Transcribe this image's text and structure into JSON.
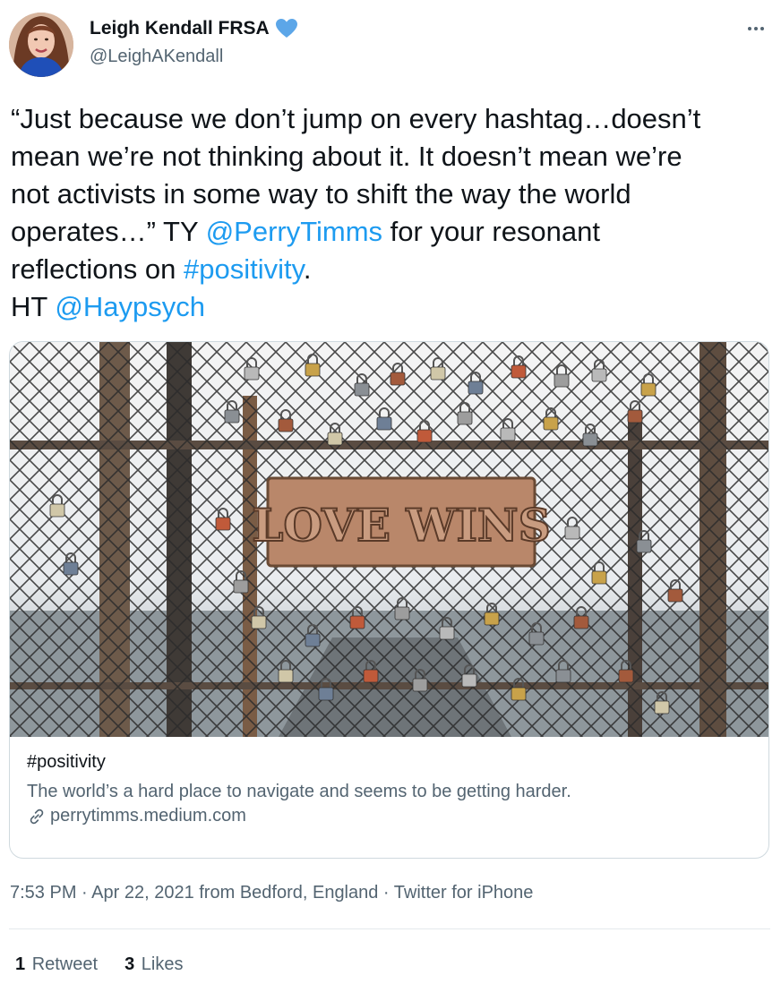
{
  "author": {
    "display_name": "Leigh Kendall FRSA",
    "handle": "@LeighAKendall",
    "verified_icon": "verified-heart-icon",
    "verified_color": "#5ca6e8"
  },
  "tweet": {
    "lines": [
      [
        {
          "t": "“Just because we don’t jump on every hashtag…doesn’t",
          "k": "text"
        }
      ],
      [
        {
          "t": "mean we’re not thinking about it. It doesn’t mean we’re",
          "k": "text"
        }
      ],
      [
        {
          "t": "not activists in some way to shift the way the world",
          "k": "text"
        }
      ],
      [
        {
          "t": "operates…” TY ",
          "k": "text"
        },
        {
          "t": "@PerryTimms",
          "k": "mention"
        },
        {
          "t": " for your resonant",
          "k": "text"
        }
      ],
      [
        {
          "t": "reflections on ",
          "k": "text"
        },
        {
          "t": "#positivity",
          "k": "hashtag"
        },
        {
          "t": ".",
          "k": "text"
        }
      ],
      [
        {
          "t": "HT ",
          "k": "text"
        },
        {
          "t": "@Haypsych",
          "k": "mention"
        }
      ]
    ]
  },
  "card": {
    "image_sign_text": "LOVE WINS",
    "title": "#positivity",
    "description": "The world’s a hard place to navigate and seems to be getting harder.",
    "domain": "perrytimms.medium.com"
  },
  "meta": {
    "time": "7:53 PM",
    "date": "Apr 22, 2021",
    "location_prefix": " from ",
    "location": "Bedford, England",
    "separator": " · ",
    "source": "Twitter for iPhone"
  },
  "stats": {
    "retweets_count": "1",
    "retweets_label": "Retweet",
    "likes_count": "3",
    "likes_label": "Likes"
  },
  "colors": {
    "link": "#1d9bf0",
    "secondary_text": "#536471",
    "primary_text": "#0f1419",
    "border": "#cfd9de"
  },
  "icons": [
    "more-icon",
    "verified-heart-icon",
    "link-icon"
  ]
}
